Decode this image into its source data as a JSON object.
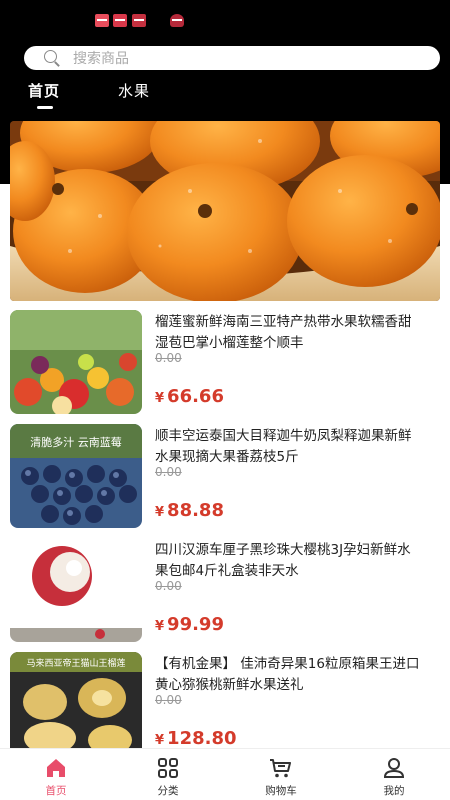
{
  "search": {
    "placeholder": "搜索商品"
  },
  "tabs": [
    {
      "label": "首页",
      "active": true
    },
    {
      "label": "水果",
      "active": false
    }
  ],
  "products": [
    {
      "title": "榴莲蜜新鲜海南三亚特产热带水果软糯香甜湿苞巴掌小榴莲整个顺丰",
      "old_price": "0.00",
      "currency": "¥",
      "price": "66.66",
      "image": "mixed-fruit-basket"
    },
    {
      "title": "顺丰空运泰国大目释迦牛奶凤梨释迦果新鲜水果现摘大果番荔枝5斤",
      "old_price": "0.00",
      "currency": "¥",
      "price": "88.88",
      "image": "blueberries",
      "image_text": "清脆多汁 云南蓝莓"
    },
    {
      "title": "四川汉源车厘子黑珍珠大樱桃3J孕妇新鲜水果包邮4斤礼盒装非天水",
      "old_price": "0.00",
      "currency": "¥",
      "price": "99.99",
      "image": "lychee"
    },
    {
      "title": "【有机金果】 佳沛奇异果16粒原箱果王进口黄心猕猴桃新鲜水果送礼",
      "old_price": "0.00",
      "currency": "¥",
      "price": "128.80",
      "image": "durian",
      "image_text": "马来西亚帝王猫山王榴莲"
    }
  ],
  "bottom_nav": [
    {
      "label": "首页",
      "icon": "home-icon",
      "active": true
    },
    {
      "label": "分类",
      "icon": "grid-icon",
      "active": false
    },
    {
      "label": "购物车",
      "icon": "cart-icon",
      "active": false
    },
    {
      "label": "我的",
      "icon": "user-icon",
      "active": false
    }
  ],
  "colors": {
    "accent": "#e84d6a",
    "price": "#d43b2b",
    "header_bg": "#000000"
  }
}
